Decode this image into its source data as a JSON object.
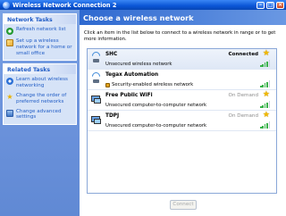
{
  "window": {
    "title": "Wireless Network Connection 2"
  },
  "sidebar": {
    "network_tasks": {
      "header": "Network Tasks",
      "items": [
        {
          "label": "Refresh network list",
          "icon": "refresh-icon"
        },
        {
          "label": "Set up a wireless network for a home or small office",
          "icon": "setup-network-icon"
        }
      ]
    },
    "related_tasks": {
      "header": "Related Tasks",
      "items": [
        {
          "label": "Learn about wireless networking",
          "icon": "info-icon"
        },
        {
          "label": "Change the order of preferred networks",
          "icon": "star-icon"
        },
        {
          "label": "Change advanced settings",
          "icon": "settings-icon"
        }
      ]
    }
  },
  "main": {
    "heading": "Choose a wireless network",
    "instructions": "Click an item in the list below to connect to a wireless network in range or to get more information.",
    "networks": [
      {
        "name": "SHC",
        "description": "Unsecured wireless network",
        "status": "Connected",
        "signal_bars": 4,
        "secured": false,
        "type": "access-point"
      },
      {
        "name": "Tegax Automation",
        "description": "Security-enabled wireless network",
        "status": "",
        "signal_bars": 4,
        "secured": true,
        "type": "access-point"
      },
      {
        "name": "Free Public WiFi",
        "description": "Unsecured computer-to-computer network",
        "status": "On Demand",
        "signal_bars": 4,
        "secured": false,
        "type": "ad-hoc"
      },
      {
        "name": "TDPJ",
        "description": "Unsecured computer-to-computer network",
        "status": "On Demand",
        "signal_bars": 4,
        "secured": false,
        "type": "ad-hoc"
      }
    ],
    "connect_label": "Connect"
  }
}
